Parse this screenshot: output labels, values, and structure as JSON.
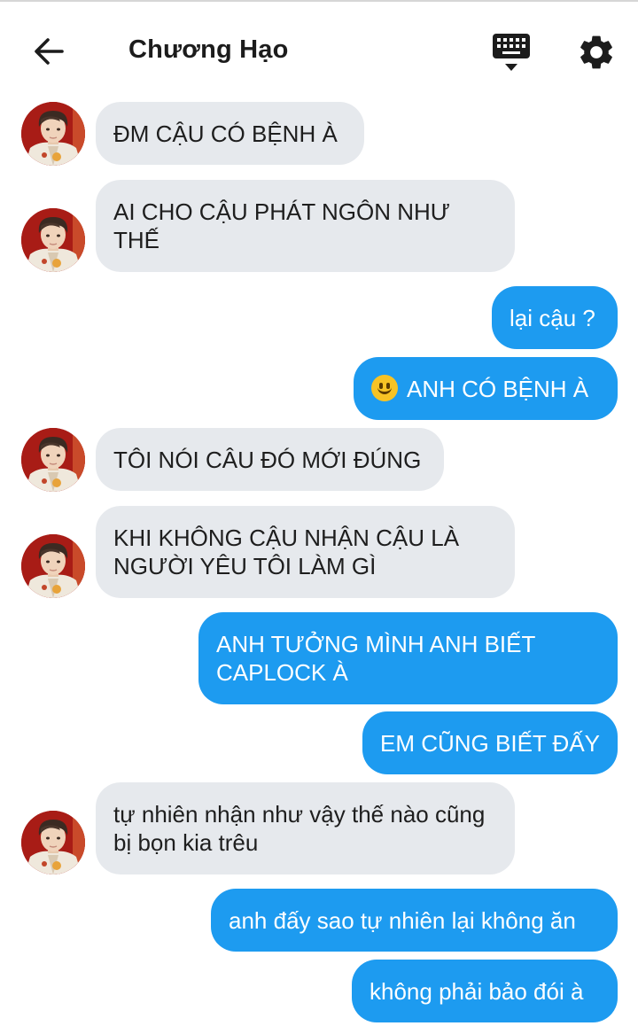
{
  "header": {
    "title": "Chương Hạo"
  },
  "messages": [
    {
      "side": "in",
      "text": "ĐM CẬU CÓ BỆNH À"
    },
    {
      "side": "in",
      "text": "AI CHO CẬU PHÁT NGÔN NHƯ THẾ"
    },
    {
      "side": "out",
      "text": "lại cậu ?"
    },
    {
      "side": "out",
      "text": "ANH CÓ BỆNH À",
      "emoji": "slightly-smiling-face-emoji"
    },
    {
      "side": "in",
      "text": "TÔI NÓI CÂU ĐÓ MỚI ĐÚNG"
    },
    {
      "side": "in",
      "text": "KHI KHÔNG CẬU NHẬN CẬU LÀ NGƯỜI YÊU TÔI LÀM GÌ"
    },
    {
      "side": "out",
      "text": "ANH TƯỞNG MÌNH ANH BIẾT CAPLOCK À"
    },
    {
      "side": "out",
      "text": "EM CŨNG BIẾT ĐẤY"
    },
    {
      "side": "in",
      "text": "tự nhiên nhận như vậy thế nào cũng bị bọn kia trêu"
    },
    {
      "side": "out",
      "text": "anh đấy sao tự nhiên lại không ăn"
    },
    {
      "side": "out",
      "text": "không phải bảo đói à"
    }
  ],
  "colors": {
    "incoming_bubble": "#e6e9ed",
    "outgoing_bubble": "#1d9bf0",
    "outgoing_text": "#ffffff",
    "incoming_text": "#1e1e1e"
  },
  "icons": [
    "back-arrow-icon",
    "keyboard-icon",
    "settings-gear-icon",
    "contact-avatar"
  ]
}
